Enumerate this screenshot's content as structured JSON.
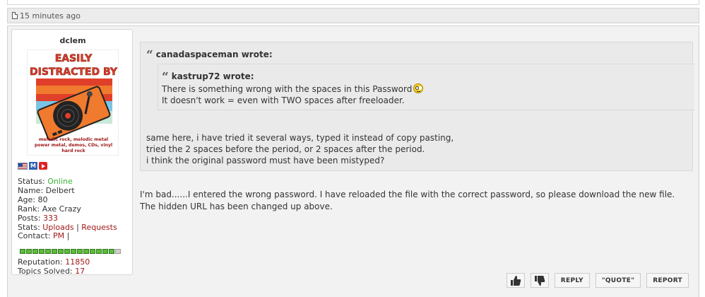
{
  "post_meta": {
    "time_ago": "15 minutes ago",
    "page_icon": "page-icon"
  },
  "user": {
    "name": "dclem",
    "avatar": {
      "headline1": "EASILY",
      "headline2": "DISTRACTED BY",
      "caption1": "melodic rock, melodic metal",
      "caption2": "power metal, demos, CDs, vinyl",
      "caption3": "hard rock",
      "colors": {
        "red": "#e0402a",
        "orange": "#f07a2e",
        "blue": "#7bc4e6",
        "mint": "#c9ead7",
        "black": "#222222"
      }
    },
    "badges": {
      "flag_icon": "us-flag-icon",
      "m_label": "M",
      "video_icon": "youtube-icon"
    },
    "status_label": "Status:",
    "status_value": "Online",
    "name_label": "Name:",
    "name_value": "Delbert",
    "age_label": "Age:",
    "age_value": "80",
    "rank_label": "Rank:",
    "rank_value": "Axe Crazy",
    "posts_label": "Posts:",
    "posts_value": "333",
    "stats_label": "Stats:",
    "uploads_link": "Uploads",
    "stats_sep": "|",
    "requests_link": "Requests",
    "contact_label": "Contact:",
    "pm_link": "PM",
    "contact_sep": "|",
    "rep_level": {
      "filled": 15,
      "total": 16
    },
    "reputation_label": "Reputation:",
    "reputation_value": "11850",
    "topics_label": "Topics Solved:",
    "topics_value": "17"
  },
  "quote": {
    "author_line": "canadaspaceman wrote:",
    "inner": {
      "author_line": "kastrup72 wrote:",
      "line1": "There is something wrong with the spaces in this Password",
      "line2": "It doesn't work = even with TWO spaces after freeloader."
    },
    "line1": "same here, i have tried it several ways, typed it instead of copy pasting,",
    "line2": "tried the 2 spaces before the period, or 2 spaces after the period.",
    "line3": "i think the original password must have been mistyped?"
  },
  "reply": {
    "line1": "I'm bad......I entered the wrong password. I have reloaded the file with the correct password, so please download the new file.",
    "line2": "The hidden URL has been changed up above."
  },
  "actions": {
    "thumbs_up_icon": "thumbs-up-icon",
    "thumbs_down_icon": "thumbs-down-icon",
    "reply": "REPLY",
    "quote": "\"QUOTE\"",
    "report": "REPORT"
  }
}
